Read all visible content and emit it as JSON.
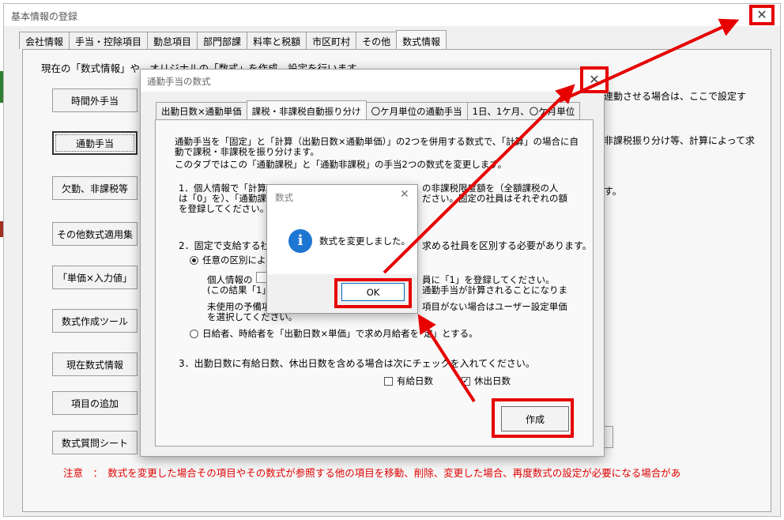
{
  "main_window": {
    "title": "基本情報の登録",
    "tabs": [
      {
        "label": "会社情報",
        "active": false
      },
      {
        "label": "手当・控除項目",
        "active": false
      },
      {
        "label": "勤怠項目",
        "active": false
      },
      {
        "label": "部門部課",
        "active": false
      },
      {
        "label": "料率と税額",
        "active": false
      },
      {
        "label": "市区町村",
        "active": false
      },
      {
        "label": "その他",
        "active": false
      },
      {
        "label": "数式情報",
        "active": true
      }
    ],
    "intro": "現在の「数式情報」や、オリジナルの「数式」を作成、設定を行います。",
    "right_texts": [
      "連動させる場合は、ここで設定す",
      "非課税振り分け等、計算によって求",
      "す。"
    ],
    "side_buttons": [
      "時間外手当",
      "通勤手当",
      "欠勤、非課税等",
      "その他数式適用集",
      "「単価×入力値」",
      "数式作成ツール",
      "現在数式情報",
      "項目の追加",
      "数式質問シート"
    ],
    "notice": "注意　：　数式を変更した場合その項目やその数式が参照する他の項目を移動、削除、変更した場合、再度数式の設定が必要になる場合があ"
  },
  "dialog": {
    "title": "通勤手当の数式",
    "tabs": [
      {
        "label": "出勤日数×通勤単価",
        "active": false
      },
      {
        "label": "課税・非課税自動振り分け",
        "active": true
      },
      {
        "label": "〇ケ月単位の通勤手当",
        "active": false
      },
      {
        "label": "1日、1ケ月、〇ケ月単位",
        "active": false
      }
    ],
    "para1": [
      "通勤手当を「固定」と「計算（出勤日数×通勤単価）」の2つを併用する数式で、「計算」の場合に自",
      "動で課税・非課税を振り分けます。",
      "このタブではこの「通勤課税」と「通勤非課税」の手当2つの数式を変更します。"
    ],
    "item1": [
      "1．個人情報で「計算」す",
      "の非課税限度額を（全額課税の人",
      "は「0」を）、「通勤課税」",
      "ださい。固定の社員はそれぞれの額",
      "を登録してください。"
    ],
    "item2_head_a": "2．固定で支給する社員",
    "item2_head_b": "求める社員を区別する必要があります。",
    "opt1_label": "任意の区別による",
    "opt1_detail": [
      "個人情報の",
      "員に「1」を登録してください。",
      "(この結果「1」が",
      "通勤手当が計算されることになりま",
      "未使用の予備項",
      "項目がない場合はユーザー設定単価",
      "を選択してください。"
    ],
    "opt2_a": "日給者、時給者を「出勤日数×単価」で求め月給者を",
    "opt2_b": "定」とする。",
    "item3": "3．出勤日数に有給日数、休出日数を含める場合は次にチェックを入れてください。",
    "check_paid": {
      "label": "有給日数",
      "checked": false
    },
    "check_holiday": {
      "label": "休出日数",
      "checked": true
    },
    "create_label": "作成"
  },
  "message_box": {
    "title": "数式",
    "text": "数式を変更しました。",
    "ok_label": "OK",
    "icon": "info-icon"
  },
  "colors": {
    "annotation_red": "#e60000",
    "notice_red": "#e00000",
    "info_blue": "#1e76d3"
  }
}
